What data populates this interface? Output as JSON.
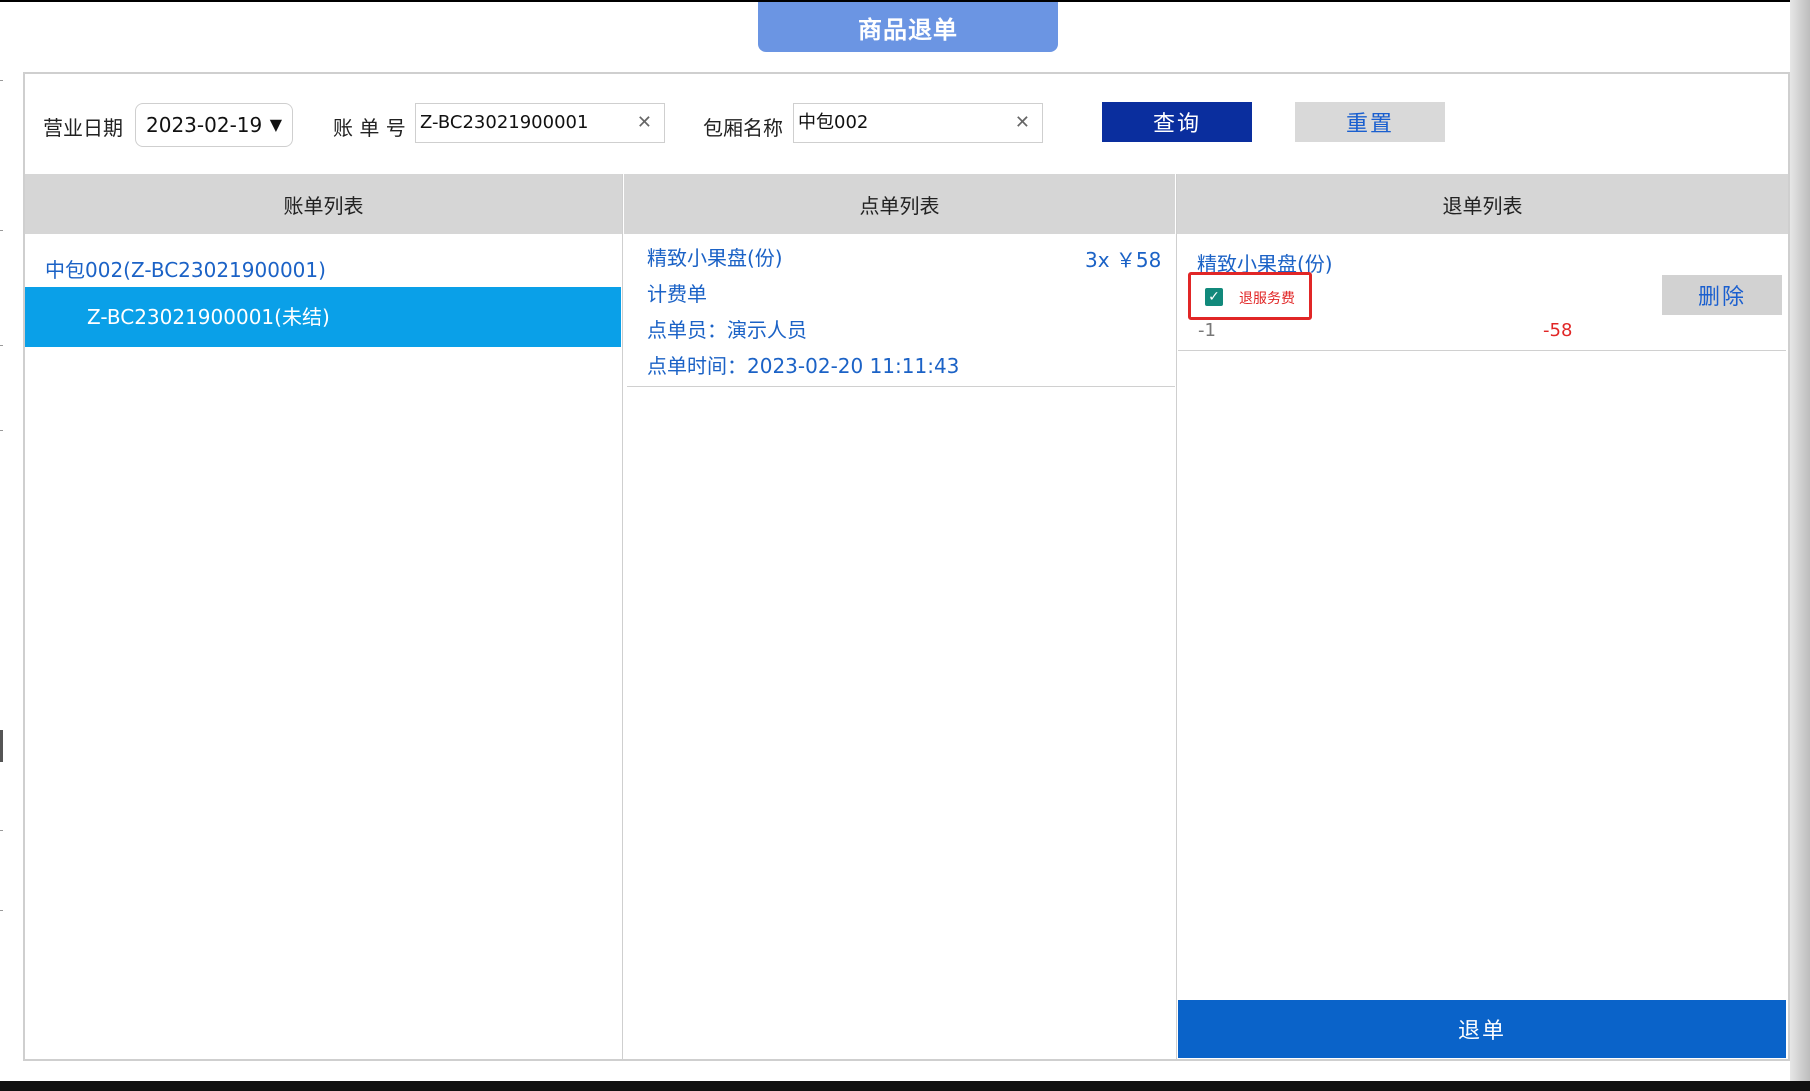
{
  "title": "商品退单",
  "search": {
    "date_label": "营业日期",
    "date_value": "2023-02-19",
    "bill_no_label": "账 单 号",
    "bill_no_value": "Z-BC23021900001",
    "room_label": "包厢名称",
    "room_value": "中包002",
    "query_label": "查询",
    "reset_label": "重置"
  },
  "columns": {
    "bills": "账单列表",
    "orders": "点单列表",
    "refunds": "退单列表"
  },
  "bills": {
    "parent": "中包002(Z-BC23021900001)",
    "child": "Z-BC23021900001(未结)"
  },
  "order": {
    "name": "精致小果盘(份)",
    "qty_price": "3x ￥58",
    "type": "计费单",
    "staff": "点单员：演示人员",
    "time": "点单时间：2023-02-20 11:11:43"
  },
  "refund": {
    "name": "精致小果盘(份)",
    "checkbox_label": "退服务费",
    "checked": true,
    "delete_label": "删除",
    "qty": "-1",
    "amount": "-58",
    "submit_label": "退单"
  },
  "colors": {
    "title_tab": "#6b95e3",
    "primary_dark": "#0a2e9e",
    "link_blue": "#1b62c6",
    "selected_row": "#0aa0e8",
    "submit_blue": "#0a63c9",
    "checkbox_green": "#11897b",
    "highlight_red": "#e12626"
  },
  "icons": {
    "dropdown": "triangle-down",
    "clear": "multiply",
    "check": "check-mark"
  }
}
